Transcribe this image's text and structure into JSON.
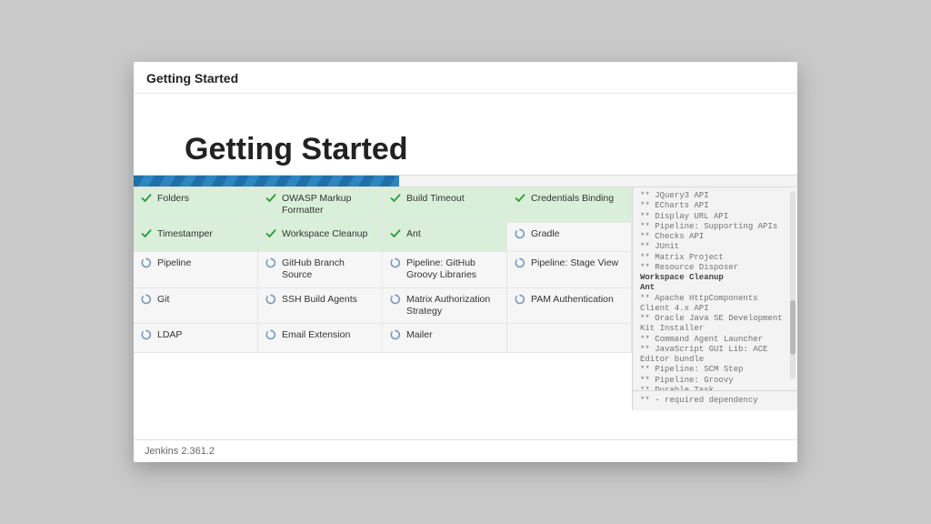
{
  "header": {
    "title": "Getting Started"
  },
  "hero": {
    "title": "Getting Started"
  },
  "progress": {
    "percent": "40%"
  },
  "plugins": {
    "row1": [
      {
        "label": "Folders",
        "state": "done"
      },
      {
        "label": "OWASP Markup Formatter",
        "state": "done"
      },
      {
        "label": "Build Timeout",
        "state": "done"
      },
      {
        "label": "Credentials Binding",
        "state": "done"
      }
    ],
    "row2": [
      {
        "label": "Timestamper",
        "state": "done"
      },
      {
        "label": "Workspace Cleanup",
        "state": "done"
      },
      {
        "label": "Ant",
        "state": "done"
      },
      {
        "label": "Gradle",
        "state": "pending"
      }
    ],
    "row3": [
      {
        "label": "Pipeline",
        "state": "pending"
      },
      {
        "label": "GitHub Branch Source",
        "state": "pending"
      },
      {
        "label": "Pipeline: GitHub Groovy Libraries",
        "state": "pending"
      },
      {
        "label": "Pipeline: Stage View",
        "state": "pending"
      }
    ],
    "row4": [
      {
        "label": "Git",
        "state": "pending"
      },
      {
        "label": "SSH Build Agents",
        "state": "pending"
      },
      {
        "label": "Matrix Authorization Strategy",
        "state": "pending"
      },
      {
        "label": "PAM Authentication",
        "state": "pending"
      }
    ],
    "row5": [
      {
        "label": "LDAP",
        "state": "pending"
      },
      {
        "label": "Email Extension",
        "state": "pending"
      },
      {
        "label": "Mailer",
        "state": "pending"
      },
      {
        "label": "",
        "state": "empty"
      }
    ]
  },
  "log": {
    "lines": [
      "** JQuery3 API",
      "** ECharts API",
      "** Display URL API",
      "** Pipeline: Supporting APIs",
      "** Checks API",
      "** JUnit",
      "** Matrix Project",
      "** Resource Disposer"
    ],
    "bold1": "Workspace Cleanup",
    "bold2": "Ant",
    "lines2": [
      "** Apache HttpComponents Client 4.x API",
      "** Oracle Java SE Development Kit Installer",
      "** Command Agent Launcher",
      "** JavaScript GUI Lib: ACE Editor bundle",
      "** Pipeline: SCM Step",
      "** Pipeline: Groovy",
      "** Durable Task"
    ],
    "footnote": "** - required dependency"
  },
  "footer": {
    "version": "Jenkins 2.361.2"
  }
}
